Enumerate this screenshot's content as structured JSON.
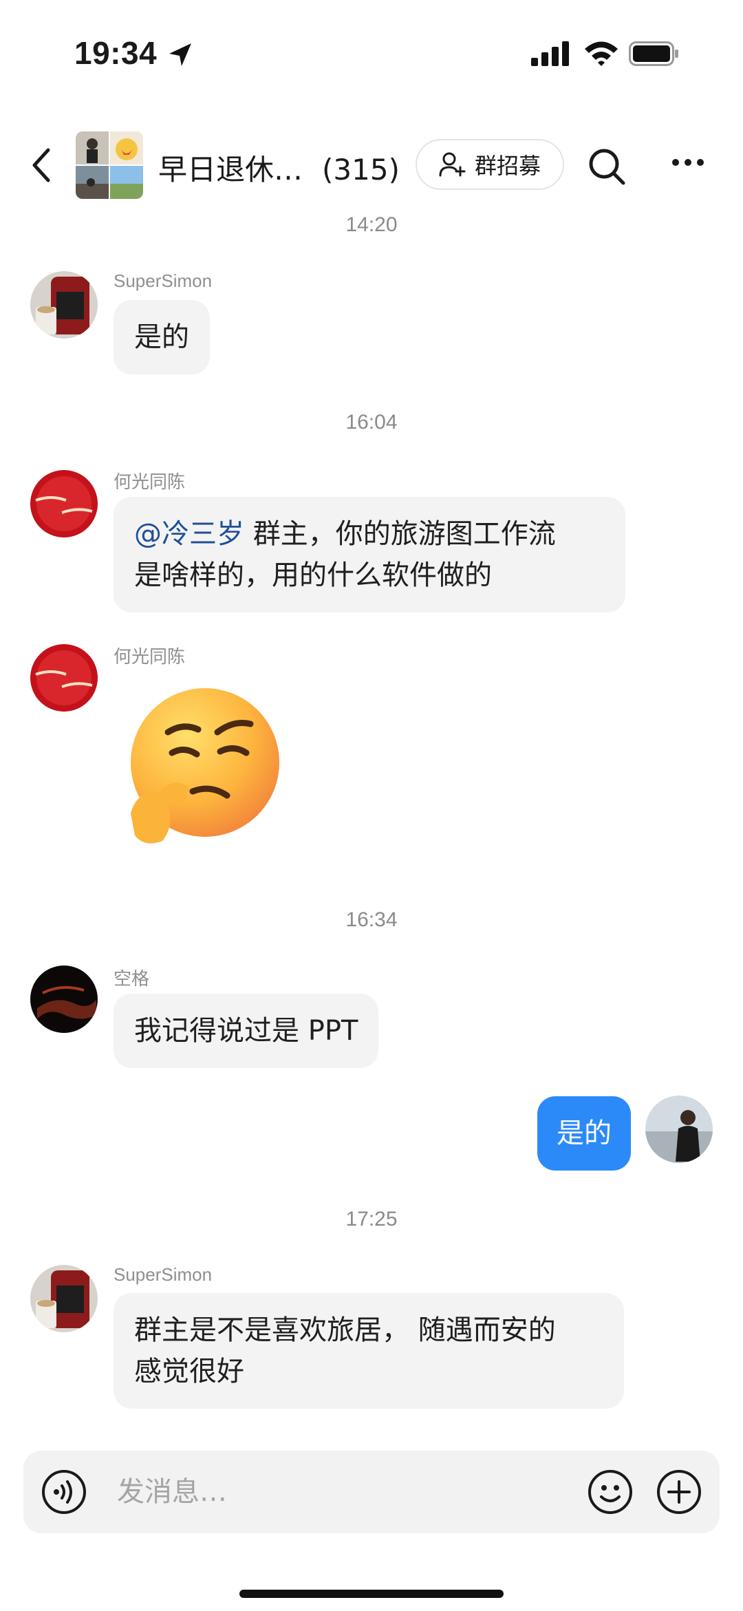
{
  "status_bar": {
    "time": "19:34"
  },
  "header": {
    "title": "早日退休…",
    "member_count": "(315)",
    "recruit_label": "群招募"
  },
  "messages": [
    {
      "timestamp": "14:20"
    },
    {
      "sender": "SuperSimon",
      "text": "是的"
    },
    {
      "timestamp": "16:04"
    },
    {
      "sender": "何光同陈",
      "mention": "@冷三岁",
      "line1": " 群主，你的旅游图工作流",
      "line2": "是啥样的，用的什么软件做的"
    },
    {
      "sender": "何光同陈",
      "sticker": "thinking-face"
    },
    {
      "timestamp": "16:34"
    },
    {
      "sender": "空格",
      "text": "我记得说过是 PPT"
    },
    {
      "self": true,
      "text": "是的"
    },
    {
      "timestamp": "17:25"
    },
    {
      "sender": "SuperSimon",
      "line1": "群主是不是喜欢旅居， 随遇而安的",
      "line2": "感觉很好"
    }
  ],
  "input": {
    "placeholder": "发消息…"
  },
  "colors": {
    "accent": "#2b8af7",
    "bubble": "#f3f3f3",
    "mention": "#1f4f99"
  }
}
